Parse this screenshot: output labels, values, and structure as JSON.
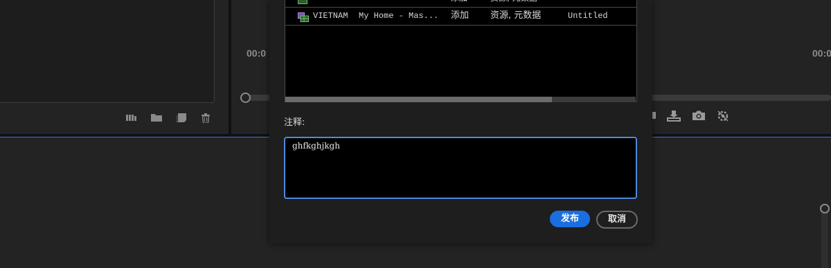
{
  "monitor": {
    "timecode_left": "00:0",
    "timecode_right": "00:0"
  },
  "left_toolbar": {
    "icons": [
      "bin-view-icon",
      "folder-icon",
      "new-item-icon",
      "trash-icon"
    ]
  },
  "monitor_toolbar": {
    "icons": [
      "marker-icon",
      "export-frame-icon",
      "camera-icon",
      "settings-icon"
    ]
  },
  "dialog": {
    "table": {
      "rows": [
        {
          "name": "",
          "sequence": "...",
          "action": "添加",
          "type": "资源, 元数据",
          "project": ""
        },
        {
          "name": "VIETNAM",
          "sequence": "My Home - Mas...",
          "action": "添加",
          "type": "资源, 元数据",
          "project": "Untitled"
        }
      ]
    },
    "notes_label": "注释:",
    "notes_value": "ghfkghjkgh",
    "publish_label": "发布",
    "cancel_label": "取消"
  },
  "colors": {
    "accent": "#1b6ee0",
    "focus_border": "#4f8be0",
    "background": "#232323",
    "dialog_bg": "#1e1e1e"
  }
}
